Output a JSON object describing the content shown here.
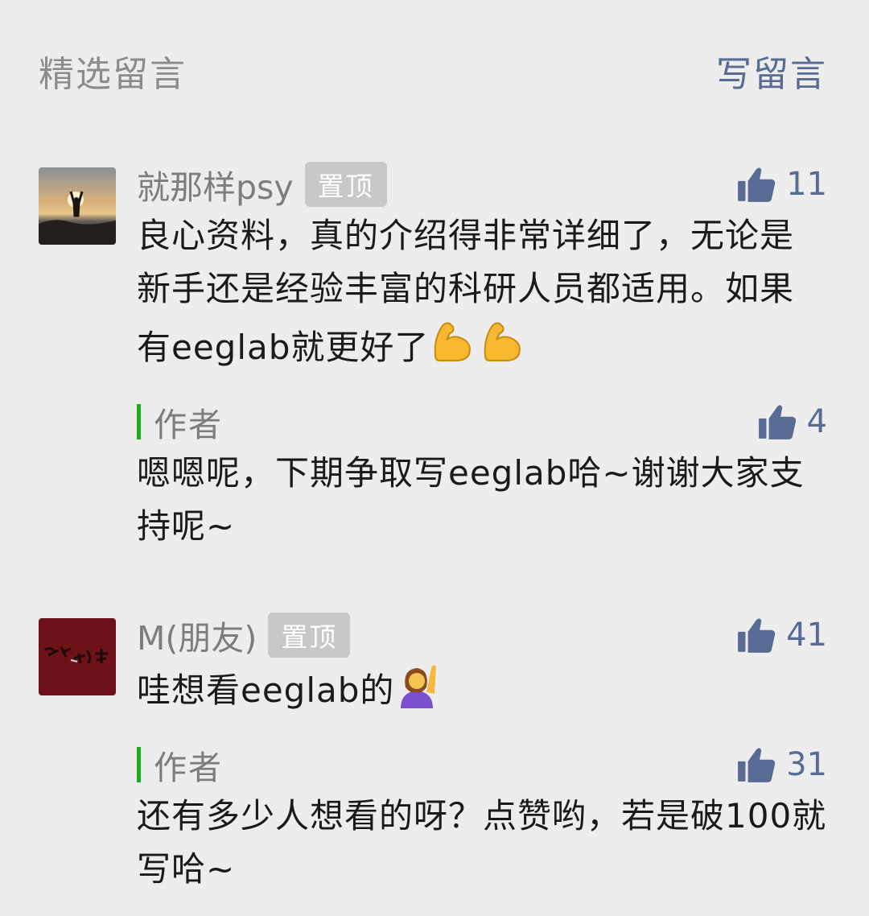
{
  "header": {
    "title": "精选留言",
    "write_label": "写留言"
  },
  "comments": [
    {
      "nickname": "就那样psy",
      "pinned_label": "置顶",
      "likes": "11",
      "content": "良心资料，真的介绍得非常详细了，无论是新手还是经验丰富的科研人员都适用。如果有eeglab就更好了",
      "emoji": [
        "flexed-biceps",
        "flexed-biceps"
      ],
      "reply": {
        "author_label": "作者",
        "likes": "4",
        "content": "嗯嗯呢，下期争取写eeglab哈~谢谢大家支持呢~"
      }
    },
    {
      "nickname": "M(朋友)",
      "pinned_label": "置顶",
      "likes": "41",
      "content": "哇想看eeglab的",
      "emoji": [
        "person-raising-hand"
      ],
      "reply": {
        "author_label": "作者",
        "likes": "31",
        "content": "还有多少人想看的呀？点赞哟，若是破100就写哈~"
      }
    }
  ],
  "colors": {
    "link": "#576b95",
    "author_bar": "#1aad19",
    "background": "#ededed"
  }
}
